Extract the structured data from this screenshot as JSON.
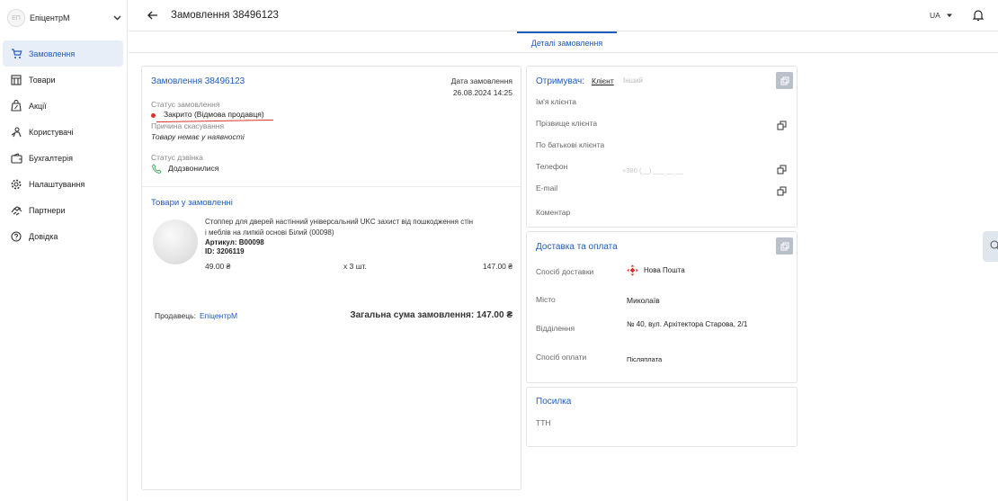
{
  "sidebar": {
    "store_name": "ЕпіцентрМ",
    "store_initials": "ЕП",
    "items": [
      {
        "label": "Замовлення",
        "icon": "cart-icon",
        "active": true
      },
      {
        "label": "Товари",
        "icon": "store-icon"
      },
      {
        "label": "Акції",
        "icon": "discount-bag-icon"
      },
      {
        "label": "Користувачі",
        "icon": "users-icon"
      },
      {
        "label": "Бухгалтерія",
        "icon": "wallet-icon"
      },
      {
        "label": "Налаштування",
        "icon": "gear-icon"
      },
      {
        "label": "Партнери",
        "icon": "handshake-icon"
      },
      {
        "label": "Довідка",
        "icon": "help-icon"
      }
    ]
  },
  "header": {
    "title": "Замовлення 38496123",
    "lang": "UA"
  },
  "tabs": {
    "active": "Деталі замовлення"
  },
  "order": {
    "title": "Замовлення 38496123",
    "date_label": "Дата замовлення",
    "date_value": "26.08.2024 14:25",
    "status_label": "Статус замовлення",
    "status_value": "Закрито (Відмова продавця)",
    "cancel_reason_label": "Причина скасування",
    "cancel_reason_value": "Товару немає у наявності",
    "call_status_label": "Статус дзвінка",
    "call_status_value": "Додзвонилися",
    "products_title": "Товари у замовленні",
    "product": {
      "name_line1": "Стоппер для дверей настінний універсальний UKC захист від пошкодження стін",
      "name_line2": "і меблів на липкій основі Білий (00098)",
      "article": "Артикул: B00098",
      "id": "ID: 3206119",
      "price": "49.00 ₴",
      "qty": "x 3 шт.",
      "sum": "147.00 ₴"
    },
    "seller_label": "Продавець:",
    "seller_value": "ЕпіцентрМ",
    "total": "Загальна сума замовлення: 147.00 ₴"
  },
  "recipient": {
    "title": "Отримувач:",
    "tab_client": "Клієнт",
    "tab_other": "Інший",
    "first_name_label": "Ім'я клієнта",
    "last_name_label": "Прізвище клієнта",
    "middle_name_label": "По батькові клієнта",
    "phone_label": "Телефон",
    "phone_placeholder": "+380 (__) ___ __ __",
    "email_label": "E-mail",
    "comment_label": "Коментар"
  },
  "delivery": {
    "title": "Доставка та оплата",
    "method_label": "Спосіб доставки",
    "method_value": "Нова Пошта",
    "city_label": "Місто",
    "city_value": "Миколаїв",
    "branch_label": "Відділення",
    "branch_value": "№ 40, вул. Архітектора Старова, 2/1",
    "payment_label": "Спосіб оплати",
    "payment_value": "Післяплата"
  },
  "parcel": {
    "title": "Посилка",
    "ttn_label": "ТТН"
  },
  "colors": {
    "accent": "#1e5bbf",
    "status_red": "#d9342b",
    "nova_poshta": "#d72b27"
  }
}
